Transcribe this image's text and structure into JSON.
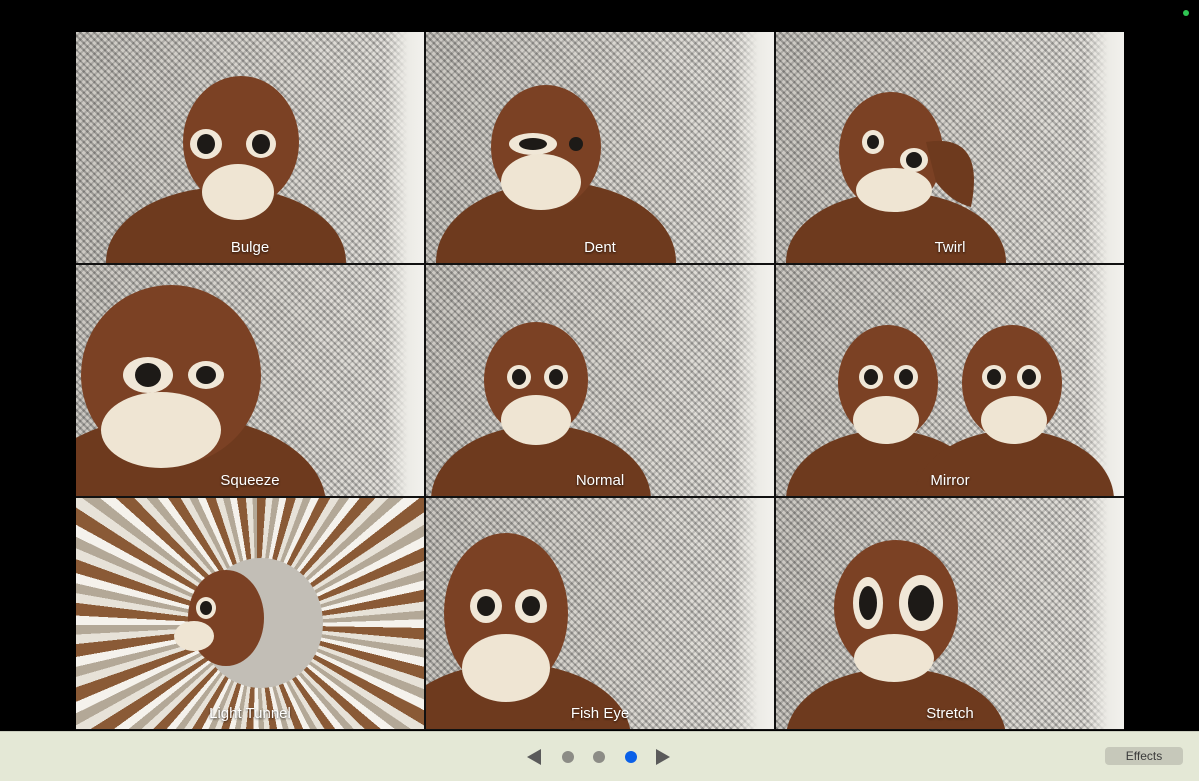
{
  "window": {
    "camera_indicator_color": "#2fc553"
  },
  "effects": [
    {
      "label": "Bulge",
      "effect": "bulge"
    },
    {
      "label": "Dent",
      "effect": "dent"
    },
    {
      "label": "Twirl",
      "effect": "twirl"
    },
    {
      "label": "Squeeze",
      "effect": "squeeze"
    },
    {
      "label": "Normal",
      "effect": "normal"
    },
    {
      "label": "Mirror",
      "effect": "mirror"
    },
    {
      "label": "Light Tunnel",
      "effect": "light-tunnel"
    },
    {
      "label": "Fish Eye",
      "effect": "fish-eye"
    },
    {
      "label": "Stretch",
      "effect": "stretch"
    }
  ],
  "toolbar": {
    "effects_label": "Effects",
    "prev_icon": "left-triangle-icon",
    "next_icon": "right-triangle-icon",
    "page_count": 3,
    "current_page": 3,
    "active_dot_color": "#0a60e8"
  }
}
